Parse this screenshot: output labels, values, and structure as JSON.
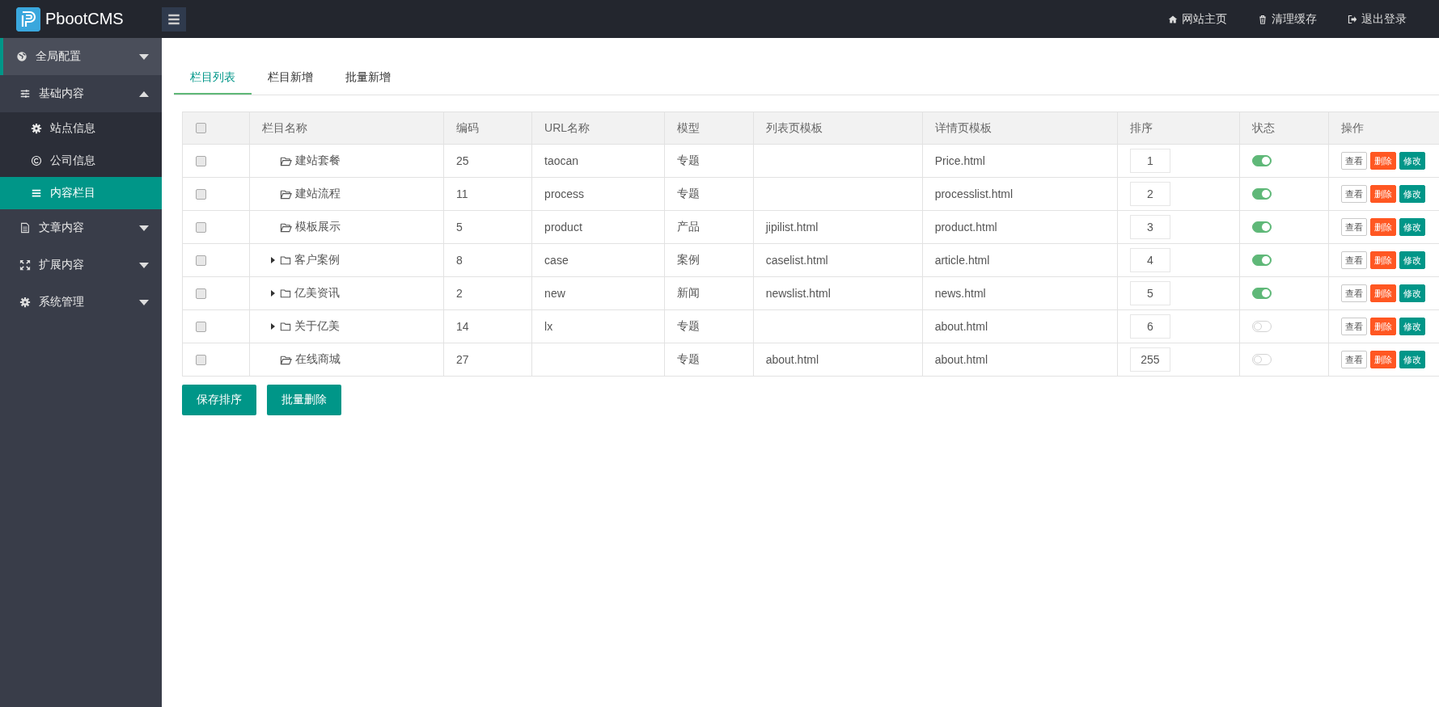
{
  "header": {
    "logo_text": "PbootCMS",
    "links": [
      {
        "label": "网站主页"
      },
      {
        "label": "清理缓存"
      },
      {
        "label": "退出登录"
      }
    ]
  },
  "sidebar": {
    "items": [
      {
        "label": "全局配置",
        "selected": true,
        "expanded": false
      },
      {
        "label": "基础内容",
        "selected": false,
        "expanded": true,
        "children": [
          {
            "label": "站点信息",
            "selected": false
          },
          {
            "label": "公司信息",
            "selected": false
          },
          {
            "label": "内容栏目",
            "selected": true
          }
        ]
      },
      {
        "label": "文章内容",
        "selected": false,
        "expanded": false
      },
      {
        "label": "扩展内容",
        "selected": false,
        "expanded": false
      },
      {
        "label": "系统管理",
        "selected": false,
        "expanded": false
      }
    ]
  },
  "tabs": [
    {
      "label": "栏目列表",
      "selected": true
    },
    {
      "label": "栏目新增",
      "selected": false
    },
    {
      "label": "批量新增",
      "selected": false
    }
  ],
  "table": {
    "header_checked": false,
    "columns": [
      "栏目名称",
      "编码",
      "URL名称",
      "模型",
      "列表页模板",
      "详情页模板",
      "排序",
      "状态",
      "操作"
    ],
    "rows": [
      {
        "checked": false,
        "has_children": false,
        "name": "建站套餐",
        "code": "25",
        "url_name": "taocan",
        "model": "专题",
        "list_template": "",
        "detail_template": "Price.html",
        "sort": "1",
        "on": true,
        "actions": [
          "查看",
          "删除",
          "修改"
        ]
      },
      {
        "checked": false,
        "has_children": false,
        "name": "建站流程",
        "code": "11",
        "url_name": "process",
        "model": "专题",
        "list_template": "",
        "detail_template": "processlist.html",
        "sort": "2",
        "on": true,
        "actions": [
          "查看",
          "删除",
          "修改"
        ]
      },
      {
        "checked": false,
        "has_children": false,
        "name": "模板展示",
        "code": "5",
        "url_name": "product",
        "model": "产品",
        "list_template": "jipilist.html",
        "detail_template": "product.html",
        "sort": "3",
        "on": true,
        "actions": [
          "查看",
          "删除",
          "修改"
        ]
      },
      {
        "checked": false,
        "has_children": true,
        "name": "客户案例",
        "code": "8",
        "url_name": "case",
        "model": "案例",
        "list_template": "caselist.html",
        "detail_template": "article.html",
        "sort": "4",
        "on": true,
        "actions": [
          "查看",
          "删除",
          "修改"
        ]
      },
      {
        "checked": false,
        "has_children": true,
        "name": "亿美资讯",
        "code": "2",
        "url_name": "new",
        "model": "新闻",
        "list_template": "newslist.html",
        "detail_template": "news.html",
        "sort": "5",
        "on": true,
        "actions": [
          "查看",
          "删除",
          "修改"
        ]
      },
      {
        "checked": false,
        "has_children": true,
        "name": "关于亿美",
        "code": "14",
        "url_name": "lx",
        "model": "专题",
        "list_template": "",
        "detail_template": "about.html",
        "sort": "6",
        "on": false,
        "actions": [
          "查看",
          "删除",
          "修改"
        ]
      },
      {
        "checked": false,
        "has_children": false,
        "name": "在线商城",
        "code": "27",
        "url_name": "",
        "model": "专题",
        "list_template": "about.html",
        "detail_template": "about.html",
        "sort": "255",
        "on": false,
        "actions": [
          "查看",
          "删除",
          "修改"
        ]
      }
    ]
  },
  "buttons": [
    {
      "label": "保存排序"
    },
    {
      "label": "批量删除"
    }
  ]
}
